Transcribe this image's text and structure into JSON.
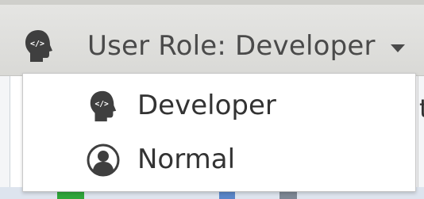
{
  "toolbar": {
    "role_selector": {
      "label": "User Role: Developer",
      "current_icon": "developer-head-icon",
      "caret_icon": "chevron-down-icon"
    }
  },
  "dropdown": {
    "items": [
      {
        "label": "Developer",
        "icon": "developer-head-icon",
        "selected": true
      },
      {
        "label": "Normal",
        "icon": "user-avatar-icon",
        "selected": false
      }
    ]
  },
  "background": {
    "partial_text": "t"
  },
  "colors": {
    "icon_fill": "#3f3f3f",
    "text": "#333333",
    "menu_bg": "#ffffff",
    "toolbar_bg": "#dcdcd9"
  }
}
